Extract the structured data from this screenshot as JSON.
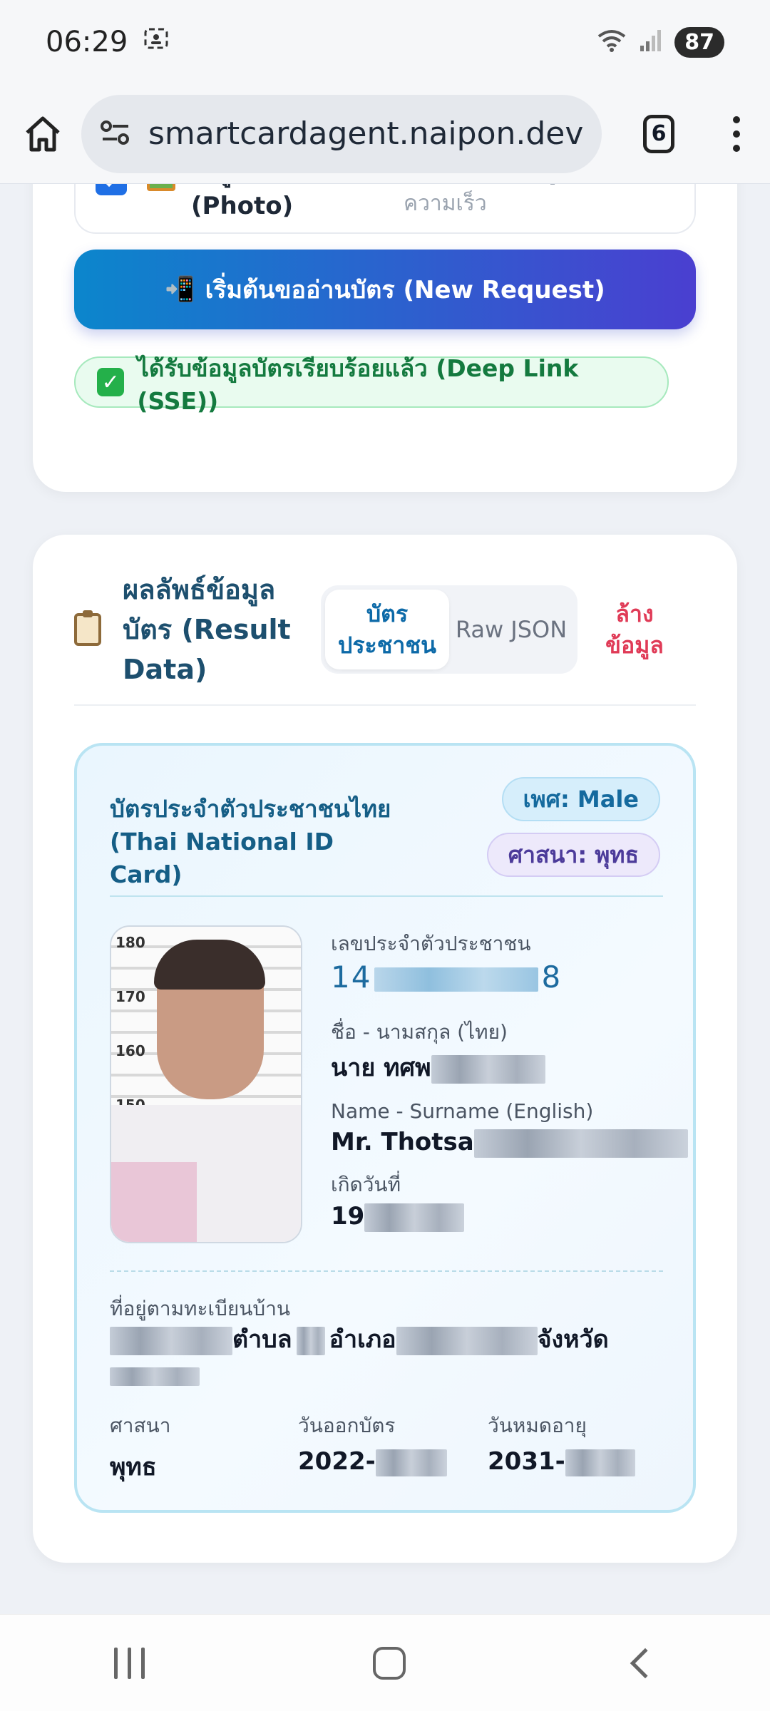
{
  "status": {
    "time": "06:29",
    "battery": "87"
  },
  "browser": {
    "url": "smartcardagent.naipon.dev",
    "tab_count": "6"
  },
  "form": {
    "photo_label": "ดึงรูปถ่ายด้วย (Photo)",
    "photo_hint": "Default: ไม่ดึงรูปเพื่อความเร็ว",
    "photo_checked": true,
    "new_request_label": "เริ่มต้นขออ่านบัตร (New Request)",
    "new_request_icon": "📲",
    "success_message": "ได้รับข้อมูลบัตรเรียบร้อยแล้ว (Deep Link (SSE))"
  },
  "result": {
    "title": "ผลลัพธ์ข้อมูลบัตร (Result Data)",
    "tabs": [
      {
        "label": "บัตรประชาชน",
        "active": true
      },
      {
        "label": "Raw JSON",
        "active": false
      }
    ],
    "clear_label": "ล้างข้อมูล"
  },
  "id_card": {
    "title": "บัตรประจำตัวประชาชนไทย (Thai National ID Card)",
    "gender_badge": "เพศ: Male",
    "religion_badge": "ศาสนา: พุทธ",
    "photo_scale": [
      "180",
      "170",
      "160",
      "150"
    ],
    "id_label": "เลขประจำตัวประชาชน",
    "id_value_prefix": "14",
    "id_value_suffix": "8",
    "name_th_label": "ชื่อ - นามสกุล (ไทย)",
    "name_th_value": "นาย ทศพ",
    "name_en_label": "Name - Surname (English)",
    "name_en_value": "Mr. Thotsa",
    "dob_label": "เกิดวันที่",
    "dob_value": "19",
    "address_label": "ที่อยู่ตามทะเบียนบ้าน",
    "address_subdistrict": "ตำบล",
    "address_district": "อำเภอ",
    "address_province": "จังหวัด",
    "religion_label": "ศาสนา",
    "religion_value": "พุทธ",
    "issue_label": "วันออกบัตร",
    "issue_value": "2022-",
    "expiry_label": "วันหมดอายุ",
    "expiry_value": "2031-"
  },
  "colors": {
    "primary_gradient_start": "#0b86cc",
    "primary_gradient_end": "#4a3fd0",
    "success": "#147a3f",
    "danger": "#e03b57",
    "card_title": "#155e86"
  }
}
